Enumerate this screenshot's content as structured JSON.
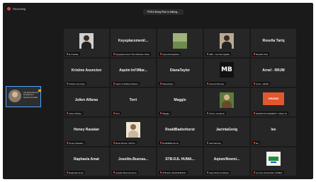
{
  "status": {
    "recording": "Recording"
  },
  "banner": {
    "speaking": "PDEA Bong Plan is talking..."
  },
  "self_view": {
    "name": "Jan Abrea Serenio",
    "subtitle": "Employment Services Provider"
  },
  "tiles": [
    {
      "big_name": "",
      "label": "EJ Gadian",
      "media": "photo"
    },
    {
      "big_name": "Keysplacement/...",
      "label": "Keysplacement/ Tina Randies Olsso",
      "media": "none"
    },
    {
      "big_name": "",
      "label": "Fayra Evangelista",
      "media": "photo-landscape"
    },
    {
      "big_name": "",
      "label": "ABS - Jan Dennigadis",
      "media": "photo-person2"
    },
    {
      "big_name": "Rosella Tariq",
      "label": "Rosella Tariq",
      "media": "none"
    },
    {
      "big_name": "Kristine Asuncion",
      "label": "Kristine Asuncion",
      "media": "none"
    },
    {
      "big_name": "Aquim Int'l/Mar...",
      "label": "Aquim Int'l/Mara Alberto",
      "media": "none"
    },
    {
      "big_name": "DianaTaylor",
      "label": "DianaTaylor",
      "media": "none"
    },
    {
      "big_name": "",
      "label": "Hannah Berniez",
      "media": "logo-mb"
    },
    {
      "big_name": "Arnel - RRJM",
      "label": "Arnel - RRJM",
      "media": "none"
    },
    {
      "big_name": "Julien Alfaras",
      "label": "Julien Alfaras",
      "media": "none"
    },
    {
      "big_name": "Terri",
      "label": "Terri",
      "media": "none"
    },
    {
      "big_name": "Maggie",
      "label": "Maggie",
      "media": "none"
    },
    {
      "big_name": "",
      "label": "Cherry Laudenio",
      "media": "photo-outdoor"
    },
    {
      "big_name": "",
      "label": "GRAND PLACEMENT / Marie Su",
      "media": "logo-grand"
    },
    {
      "big_name": "Honey Rasalan",
      "label": "Honey Rasalan",
      "media": "none"
    },
    {
      "big_name": "",
      "label": "Rosa Rowen Verizon",
      "media": "photo-doc"
    },
    {
      "big_name": "RoaldBadenhorst",
      "label": "RoaldBadenhorst",
      "media": "none"
    },
    {
      "big_name": "JacintaGreig",
      "label": "JacintaGreig",
      "media": "none"
    },
    {
      "big_name": "lee",
      "label": "lee",
      "media": "none"
    },
    {
      "big_name": "Raphaela Amat",
      "label": "Raphaela Amat",
      "media": "none"
    },
    {
      "big_name": "Joselito.Buenav...",
      "label": "Joselito.Buenaventura",
      "media": "none"
    },
    {
      "big_name": "STB-DJL HUMA...",
      "label": "STB-DJL HUMAN/MANC",
      "media": "none"
    },
    {
      "big_name": "Aqium/Noemi...",
      "label": "Aqium/Noemi Alberto",
      "media": "none"
    },
    {
      "big_name": "",
      "label": "Jo Anne Zosobrado CAMEX",
      "media": "logo-camex"
    }
  ],
  "logo_text": {
    "mb": "MB",
    "grand": "GRAND"
  }
}
